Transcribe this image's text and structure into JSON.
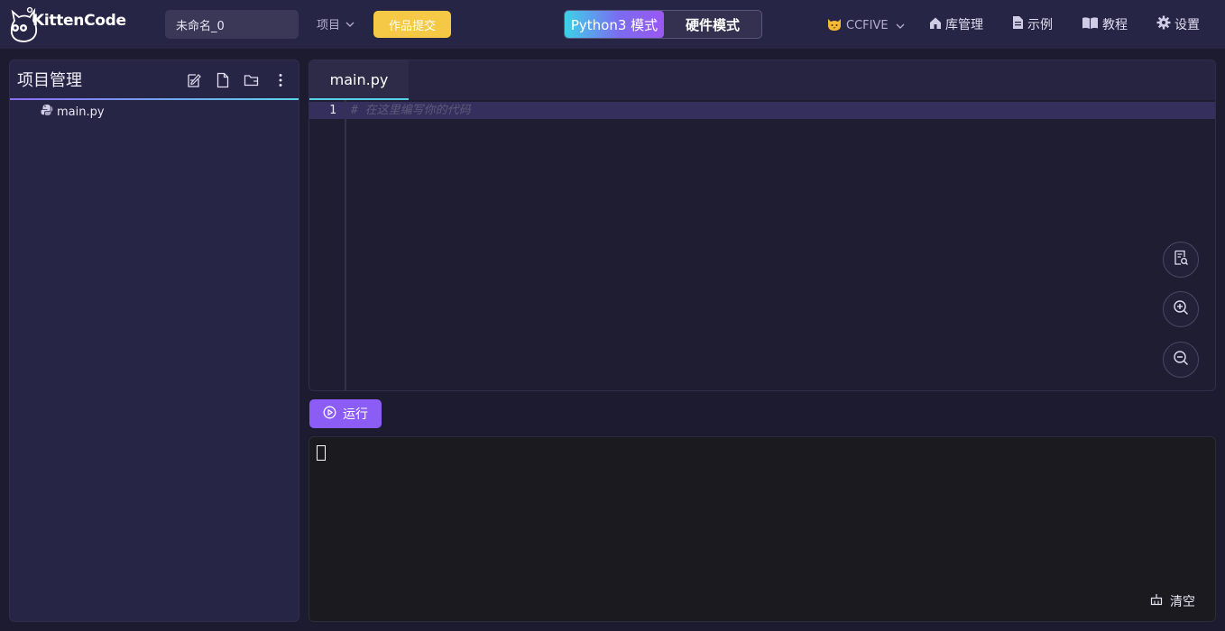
{
  "app": {
    "logo_text": "KittenCode"
  },
  "header": {
    "project_name": "未命名_0",
    "project_menu_label": "项目",
    "submit_label": "作品提交",
    "mode_python_label": "Python3 模式",
    "mode_hardware_label": "硬件模式",
    "user_name": "CCFIVE",
    "nav": {
      "library": "库管理",
      "examples": "示例",
      "tutorial": "教程",
      "settings": "设置"
    }
  },
  "sidebar": {
    "title": "项目管理",
    "files": [
      {
        "name": "main.py",
        "icon": "python-icon"
      }
    ]
  },
  "editor": {
    "tabs": [
      {
        "label": "main.py",
        "active": true
      }
    ],
    "lines": [
      {
        "number": "1",
        "text": "# 在这里编写你的代码"
      }
    ]
  },
  "run": {
    "label": "运行"
  },
  "console": {
    "clear_label": "清空"
  },
  "colors": {
    "accent_purple": "#8b5cf6",
    "submit_yellow": "#f5c945",
    "tab_underline": "#56d1e5",
    "topbar_bg": "#272545"
  }
}
